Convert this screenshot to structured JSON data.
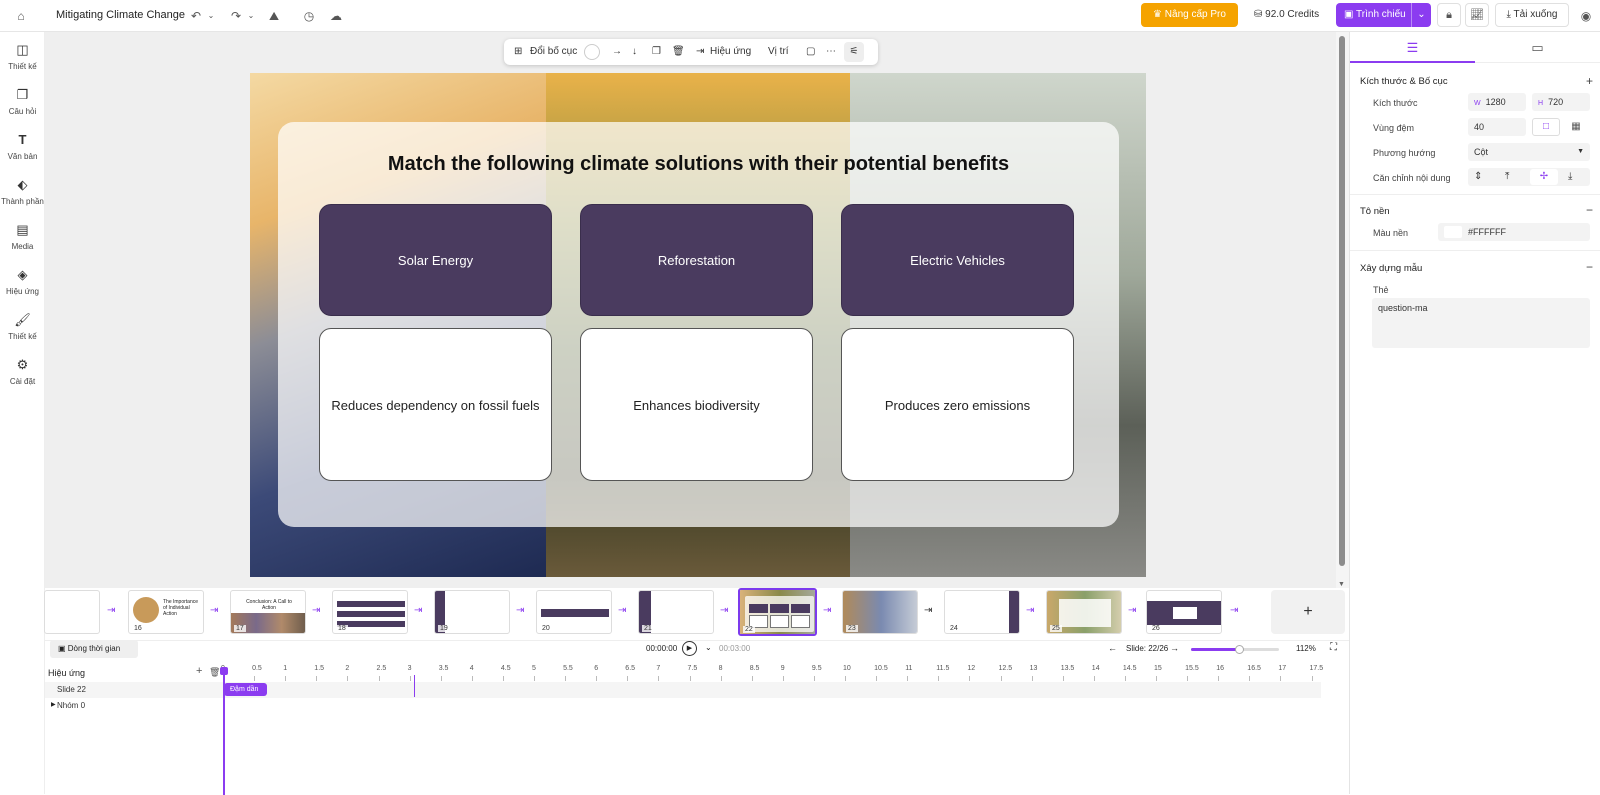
{
  "topbar": {
    "doc_title": "Mitigating Climate Change",
    "upgrade_label": "Nâng cấp Pro",
    "credits": "92.0 Credits",
    "present_label": "Trình chiếu",
    "download_label": "Tải xuống"
  },
  "leftnav": {
    "items": [
      {
        "label": "Thiết kế"
      },
      {
        "label": "Câu hỏi"
      },
      {
        "label": "Văn bản"
      },
      {
        "label": "Thành phần"
      },
      {
        "label": "Media"
      },
      {
        "label": "Hiệu ứng"
      },
      {
        "label": "Thiết kế"
      },
      {
        "label": "Cài đặt"
      }
    ]
  },
  "toolbar": {
    "layout_label": "Đổi bố cục",
    "effects_label": "Hiệu ứng",
    "position_label": "Vị trí"
  },
  "slide": {
    "title": "Match the following climate solutions with their potential benefits",
    "top_cards": [
      "Solar Energy",
      "Reforestation",
      "Electric Vehicles"
    ],
    "bottom_cards": [
      "Reduces dependency on fossil fuels",
      "Enhances biodiversity",
      "Produces zero emissions"
    ]
  },
  "rightpanel": {
    "size_section": "Kích thước & Bố cục",
    "size_label": "Kích thước",
    "width_prefix": "W",
    "width": "1280",
    "height_prefix": "H",
    "height": "720",
    "padding_label": "Vùng đệm",
    "padding": "40",
    "direction_label": "Phương hướng",
    "direction": "Cột",
    "align_label": "Căn chỉnh nội dung",
    "fill_section": "Tô nền",
    "bg_color_label": "Màu nền",
    "bg_color": "#FFFFFF",
    "template_section": "Xây dựng mẫu",
    "tag_label": "Thẻ",
    "tag_value": "question-ma"
  },
  "thumbnails": [
    {
      "num": ""
    },
    {
      "num": "16"
    },
    {
      "num": "17"
    },
    {
      "num": "18"
    },
    {
      "num": "19"
    },
    {
      "num": "20"
    },
    {
      "num": "21"
    },
    {
      "num": "22"
    },
    {
      "num": "23"
    },
    {
      "num": "24"
    },
    {
      "num": "25"
    },
    {
      "num": "26"
    }
  ],
  "thumb_titles": {
    "t16": "The Importance of Individual Action",
    "t17": "Conclusion: A Call to Action"
  },
  "timeline": {
    "timeline_button": "Dòng thời gian",
    "current_time": "00:00:00",
    "total_time": "00:03:00",
    "slide_counter": "Slide: 22/26",
    "zoom": "112%",
    "effects_header": "Hiệu ứng",
    "row_slide": "Slide 22",
    "row_group": "Nhóm 0",
    "clip_label": "Đậm dần",
    "ticks": [
      "0",
      "0.5",
      "1",
      "1.5",
      "2",
      "2.5",
      "3",
      "3.5",
      "4",
      "4.5",
      "5",
      "5.5",
      "6",
      "6.5",
      "7",
      "7.5",
      "8",
      "8.5",
      "9",
      "9.5",
      "10",
      "10.5",
      "11",
      "11.5",
      "12",
      "12.5",
      "13",
      "13.5",
      "14",
      "14.5",
      "15",
      "15.5",
      "16",
      "16.5",
      "17",
      "17.5"
    ]
  },
  "colors": {
    "accent": "#8b3cf0",
    "pro": "#f5a300",
    "card_dark": "#4a3b5f"
  }
}
